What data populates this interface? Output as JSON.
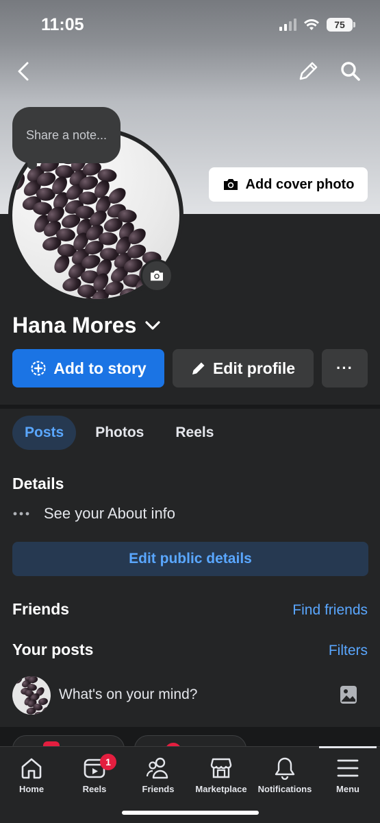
{
  "status_bar": {
    "time": "11:05",
    "battery": "75"
  },
  "header": {
    "back_icon": "chevron-left-icon",
    "edit_icon": "pencil-icon",
    "search_icon": "search-icon"
  },
  "cover": {
    "add_cover_label": "Add cover photo"
  },
  "note": {
    "placeholder": "Share a note..."
  },
  "profile": {
    "name": "Hana Mores",
    "add_story_label": "Add to story",
    "edit_profile_label": "Edit profile",
    "more_label": "···"
  },
  "tabs": [
    {
      "label": "Posts",
      "active": true
    },
    {
      "label": "Photos",
      "active": false
    },
    {
      "label": "Reels",
      "active": false
    }
  ],
  "details": {
    "title": "Details",
    "about_label": "See your About info",
    "edit_public_label": "Edit public details"
  },
  "friends": {
    "title": "Friends",
    "find_label": "Find friends"
  },
  "your_posts": {
    "title": "Your posts",
    "filters_label": "Filters",
    "composer_placeholder": "What's on your mind?"
  },
  "bottom_nav": {
    "items": [
      {
        "label": "Home",
        "icon": "home-icon"
      },
      {
        "label": "Reels",
        "icon": "reels-icon",
        "badge": "1"
      },
      {
        "label": "Friends",
        "icon": "friends-icon"
      },
      {
        "label": "Marketplace",
        "icon": "marketplace-icon"
      },
      {
        "label": "Notifications",
        "icon": "bell-icon"
      },
      {
        "label": "Menu",
        "icon": "menu-icon",
        "active": true
      }
    ]
  },
  "colors": {
    "accent": "#1b74e4",
    "link": "#5aa7ff",
    "background": "#242526",
    "badge": "#e41e3f"
  }
}
